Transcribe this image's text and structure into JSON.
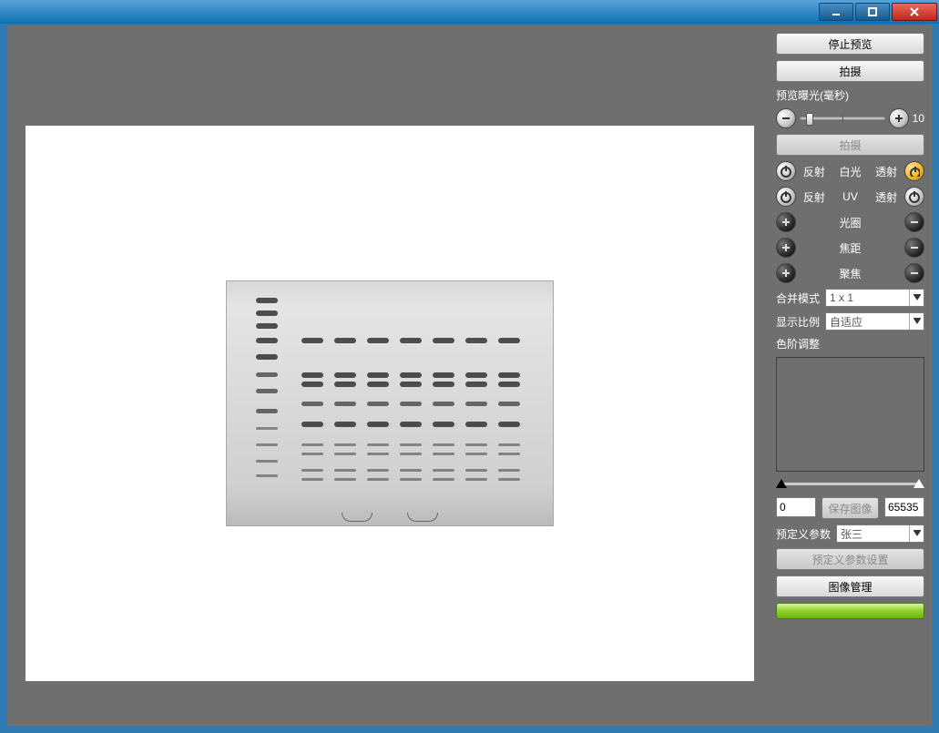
{
  "window": {
    "minimize_icon": "minimize-icon",
    "maximize_icon": "maximize-icon",
    "close_icon": "close-icon"
  },
  "panel": {
    "stop_preview": "停止预览",
    "capture": "拍摄",
    "preview_exposure_label": "预览曝光(毫秒)",
    "exposure_value": "10",
    "capture_disabled": "拍摄",
    "light": {
      "reflect1": "反射",
      "white": "白光",
      "trans1": "透射",
      "reflect2": "反射",
      "uv": "UV",
      "trans2": "透射"
    },
    "aperture": "光圈",
    "focal_length": "焦距",
    "focus": "聚焦",
    "merge_mode_label": "合并模式",
    "merge_mode_value": "1 x 1",
    "display_ratio_label": "显示比例",
    "display_ratio_value": "自适应",
    "tone_adjust_label": "色阶调整",
    "hist_low": "0",
    "save_image": "保存图像",
    "hist_high": "65535",
    "preset_label": "预定义参数",
    "preset_value": "张三",
    "preset_settings": "预定义参数设置",
    "image_manage": "图像管理"
  }
}
